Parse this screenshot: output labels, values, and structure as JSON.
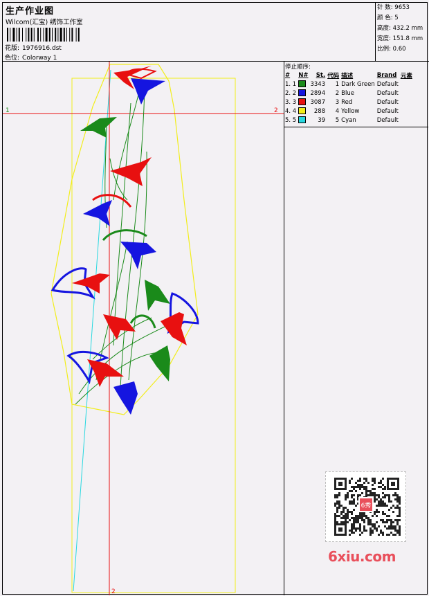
{
  "header": {
    "title": "生产作业图",
    "company": "Wilcom(汇宝) 绣饰工作室",
    "pattern_label": "花版:",
    "pattern_value": "1976916.dst",
    "colorway_label": "色位:",
    "colorway_value": "Colorway 1"
  },
  "stats": {
    "stitches_label": "针 数:",
    "stitches_value": "9653",
    "colors_label": "颜 色:",
    "colors_value": "5",
    "height_label": "高度:",
    "height_value": "432.2 mm",
    "width_label": "宽度:",
    "width_value": "151.8 mm",
    "scale_label": "比例:",
    "scale_value": "0.60"
  },
  "sequence": {
    "title": "停止顺序:",
    "headers": [
      "#",
      "N#",
      "St.",
      "代码",
      "描述",
      "Brand",
      "元素"
    ],
    "rows": [
      {
        "idx": "1. 1",
        "color": "#1a8a1a",
        "stitches": "3343",
        "code": "1",
        "desc": "Dark Green",
        "brand": "Default"
      },
      {
        "idx": "2. 2",
        "color": "#1515e0",
        "stitches": "2894",
        "code": "2",
        "desc": "Blue",
        "brand": "Default"
      },
      {
        "idx": "3. 3",
        "color": "#e81010",
        "stitches": "3087",
        "code": "3",
        "desc": "Red",
        "brand": "Default"
      },
      {
        "idx": "4. 4",
        "color": "#f2ee1a",
        "stitches": "288",
        "code": "4",
        "desc": "Yellow",
        "brand": "Default"
      },
      {
        "idx": "5. 5",
        "color": "#27d8e0",
        "stitches": "39",
        "code": "5",
        "desc": "Cyan",
        "brand": "Default"
      }
    ]
  },
  "axes": {
    "h_left": "1",
    "h_right": "2",
    "v_bottom": "2"
  },
  "watermark": "6xiu.com",
  "qr_badge": "6秀"
}
